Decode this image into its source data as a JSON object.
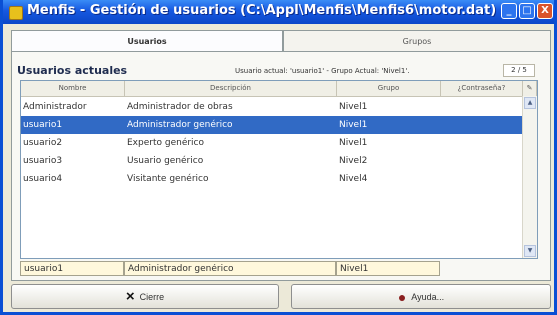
{
  "window": {
    "title": "Menfis - Gestión de usuarios (C:\\Appl\\Menfis\\Menfis6\\motor.dat)",
    "minimize_label": "_",
    "maximize_label": "□",
    "close_label": "X"
  },
  "tabs": [
    {
      "label": "Usuarios"
    },
    {
      "label": "Grupos"
    }
  ],
  "section": {
    "title": "Usuarios actuales",
    "current_user_info": "Usuario actual: 'usuario1' - Grupo Actual: 'Nivel1'.",
    "page_counter": "2 / 5"
  },
  "table": {
    "columns": [
      "Nombre",
      "Descripción",
      "Grupo",
      "¿Contraseña?"
    ],
    "rows": [
      {
        "name": "Administrador",
        "description": "Administrador de obras",
        "group": "Nivel1"
      },
      {
        "name": "usuario1",
        "description": "Administrador genérico",
        "group": "Nivel1"
      },
      {
        "name": "usuario2",
        "description": "Experto genérico",
        "group": "Nivel1"
      },
      {
        "name": "usuario3",
        "description": "Usuario genérico",
        "group": "Nivel2"
      },
      {
        "name": "usuario4",
        "description": "Visitante genérico",
        "group": "Nivel4"
      }
    ]
  },
  "editor": {
    "name": "usuario1",
    "description": "Administrador genérico",
    "group": "Nivel1"
  },
  "buttons": {
    "close_label": "Cierre",
    "help_label": "Ayuda..."
  },
  "icons": {
    "close": "close-icon",
    "help": "help-icon",
    "app": "app-icon"
  },
  "colors": {
    "title_bar": "#0a46c8",
    "selected_row": "#316ac5",
    "editor_background": "#fff8dc"
  }
}
